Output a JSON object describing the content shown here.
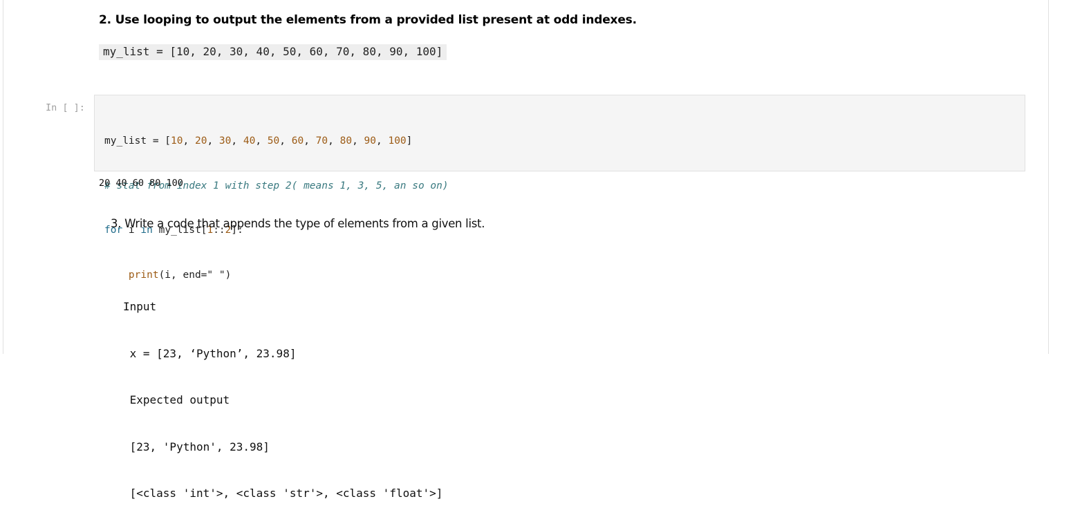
{
  "cell1": {
    "heading": "2. Use looping to output the elements from a provided list present at odd indexes.",
    "inline_code": "my_list = [10, 20, 30, 40, 50, 60, 70, 80, 90, 100]"
  },
  "code_cell": {
    "prompt": "In [ ]:",
    "line1": {
      "var": "my_list",
      "op": " = [",
      "nums": [
        "10",
        "20",
        "30",
        "40",
        "50",
        "60",
        "70",
        "80",
        "90",
        "100"
      ],
      "sep": ", ",
      "end": "]"
    },
    "line2_comment": "# stat from index 1 with step 2( means 1, 3, 5, an so on)",
    "line3": {
      "kw_for": "for",
      "var_i": " i ",
      "kw_in": "in",
      "rest_a": " my_list[",
      "n1": "1",
      "colons": "::",
      "n2": "2",
      "rest_b": "]:"
    },
    "line4": {
      "indent": "    ",
      "fn": "print",
      "args": "(i, end=\" \")"
    }
  },
  "output": {
    "text": "20 40 60 80 100"
  },
  "cell3": {
    "text": "3. Write a code that appends the type of elements from a given list.",
    "pre_lines": [
      "Input",
      " x = [23, ‘Python’, 23.98]",
      " Expected output",
      " [23, 'Python', 23.98]",
      " [<class 'int'>, <class 'str'>, <class 'float'>]"
    ]
  }
}
